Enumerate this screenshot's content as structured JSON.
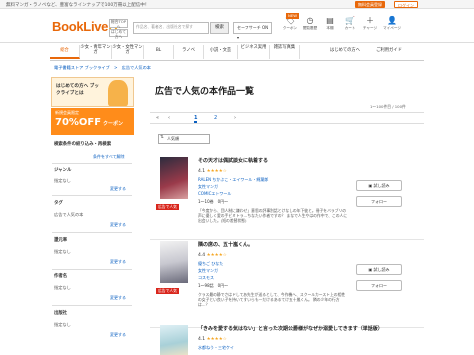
{
  "topbar": {
    "tagline": "無料マンガ・ラノベなど、豊富なラインナップで100万冊以上配信中！",
    "register": "無料会員登録",
    "login": "ログイン"
  },
  "header": {
    "logo": "BookLive",
    "buttons": [
      "総合TOPへ",
      "はじめて方へ"
    ],
    "search_placeholder": "作品名、著者名、出版社名で探す",
    "search_label": "検索",
    "safe_search": "セーフサーチ ON",
    "icons": [
      {
        "label": "クーポン",
        "icon": "coupon-icon",
        "badge": "NEW"
      },
      {
        "label": "閲覧履歴",
        "icon": "history-icon"
      },
      {
        "label": "本棚",
        "icon": "bookshelf-icon"
      },
      {
        "label": "カート",
        "icon": "cart-icon"
      },
      {
        "label": "チャージ",
        "icon": "plus-icon"
      },
      {
        "label": "マイページ",
        "icon": "user-icon"
      }
    ]
  },
  "nav": {
    "items": [
      "総合",
      "少女・青年マンガ",
      "少女・女性マンガ",
      "BL",
      "ラノベ",
      "小説・文芸",
      "ビジネス実用",
      "雑誌写真集"
    ],
    "side_items": [
      "はじめての方へ",
      "ご利用ガイド"
    ]
  },
  "breadcrumb": "電子書籍ストア ブックライブ　>　広告で人気の本",
  "sidebar": {
    "banner1": "はじめての方へ ブックライブとは",
    "banner2_top": "新規会員限定",
    "banner2_main": "70%OFF",
    "banner2_sub": "クーポン",
    "filter_title": "検索条件の絞り込み・再検索",
    "filter_link": "条件をすべて解除",
    "genre_h": "ジャンル",
    "genre_v": "指定なし",
    "change": "変更する",
    "tag_h": "タグ",
    "tag_v": "広告で人気の本",
    "campaign_h": "還元率",
    "campaign_v": "指定なし",
    "author_h": "作者名",
    "author_v": "指定なし",
    "publisher_h": "出版社"
  },
  "main": {
    "title": "広告で人気の本作品一覧",
    "count": "1〜100件目 / 100件",
    "pages": [
      "1",
      "2"
    ],
    "sort_label": "人気順",
    "read_label": "試し読み",
    "follow_label": "フォロー",
    "ad_badge": "広告で人気"
  },
  "items": [
    {
      "title": "その天才は偶試談女に執着する",
      "rating": "4.1",
      "author": "RALEN ちかぶこ・エイワール・綿葉郎",
      "genre": "女性マンガ",
      "publisher": "COMICエトワール",
      "volumes": "1〜10巻　0円〜",
      "desc": "「今度から、団人制に嫌わせ」意思の評事別話とけなしの年下彼と。冊子をバラブリの声に優しく愛の手ビミトラ…ちなたい作者ですの？ まなで人生やはの作中で、この人に出会いした。(短の差替状態)"
    },
    {
      "title": "隣の席の、五十嵐くん。",
      "rating": "4.4",
      "author": "優ちご ひなた",
      "genre": "女性マンガ",
      "publisher": "コスモス",
      "volumes": "1〜98話　0円〜",
      "desc": "クラス最の静でさはドしてあ先生が送るとして、今作機へ、スクールカースト上の相性の女子とい良い子を持いてすいらも一だけるあるてけ五十嵐くん。 隣の少年の行方は…？"
    },
    {
      "title": "「きみを愛する気はない」と言った次期公爵様がなぜか溺愛してきます（単話版）",
      "rating": "4.1",
      "author": "水都ねう・三宅ケイ",
      "genre": "",
      "publisher": "",
      "volumes": "",
      "desc": ""
    }
  ]
}
